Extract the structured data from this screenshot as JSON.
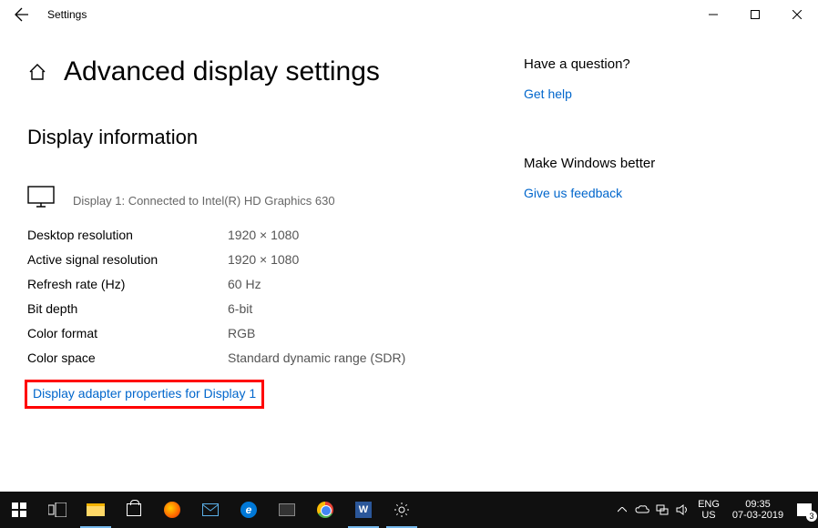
{
  "window": {
    "title": "Settings"
  },
  "page": {
    "heading": "Advanced display settings",
    "section": "Display information",
    "display_line": "Display 1: Connected to Intel(R) HD Graphics 630",
    "props": [
      {
        "k": "Desktop resolution",
        "v": "1920 × 1080"
      },
      {
        "k": "Active signal resolution",
        "v": "1920 × 1080"
      },
      {
        "k": "Refresh rate (Hz)",
        "v": "60 Hz"
      },
      {
        "k": "Bit depth",
        "v": "6-bit"
      },
      {
        "k": "Color format",
        "v": "RGB"
      },
      {
        "k": "Color space",
        "v": "Standard dynamic range (SDR)"
      }
    ],
    "adapter_link": "Display adapter properties for Display 1"
  },
  "side": {
    "question_hdr": "Have a question?",
    "get_help": "Get help",
    "better_hdr": "Make Windows better",
    "feedback": "Give us feedback"
  },
  "taskbar": {
    "lang1": "ENG",
    "lang2": "US",
    "time": "09:35",
    "date": "07-03-2019",
    "notif_count": "3"
  }
}
